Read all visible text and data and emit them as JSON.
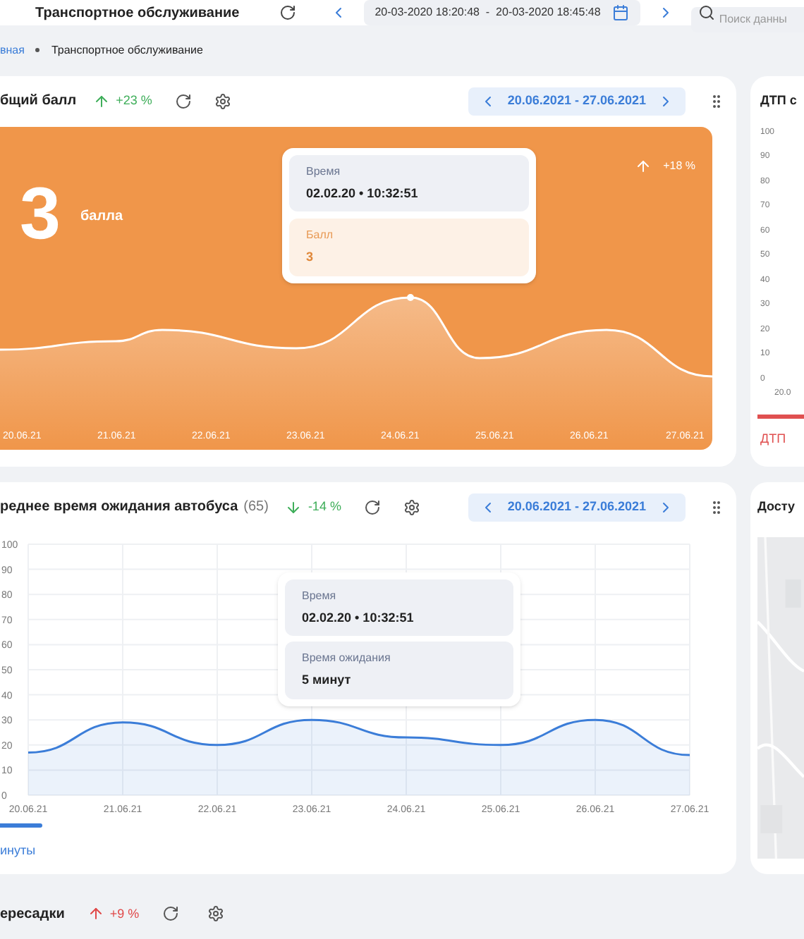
{
  "header": {
    "title": "Транспортное обслуживание",
    "date_range": "20-03-2020 18:20:48  -  20-03-2020 18:45:48",
    "search": {
      "placeholder": "Поиск данны"
    }
  },
  "breadcrumbs": [
    {
      "label": "вная",
      "selected": false
    },
    {
      "label": "Транспортное обслуживание",
      "selected": true
    }
  ],
  "score_card": {
    "title": "бщий балл",
    "trend": {
      "rising": true,
      "positive": true,
      "text": "+23 %"
    },
    "date_range": "20.06.2021 - 27.06.2021",
    "score": "3",
    "score_unit": "балла",
    "change": {
      "rising": true,
      "text": "+18 %"
    },
    "tooltip": [
      {
        "label": "Время",
        "value": "02.02.20 • 10:32:51",
        "kind": "neutral"
      },
      {
        "label": "Балл",
        "value": "3",
        "kind": "accent"
      }
    ],
    "x_labels": [
      "20.06.21",
      "21.06.21",
      "22.06.21",
      "23.06.21",
      "24.06.21",
      "25.06.21",
      "26.06.21",
      "27.06.21"
    ]
  },
  "wait_card": {
    "title": "реднее время ожидания автобуса",
    "count": "(65)",
    "trend": {
      "rising": false,
      "positive": true,
      "text": "-14 %"
    },
    "date_range": "20.06.2021 - 27.06.2021",
    "chart_data": {
      "type": "area",
      "grid": true,
      "categories": [
        "20.06.21",
        "21.06.21",
        "22.06.21",
        "23.06.21",
        "24.06.21",
        "25.06.21",
        "26.06.21",
        "27.06.21"
      ],
      "series": [
        {
          "name": "инуты",
          "color": "#3b7dd8",
          "values": [
            17,
            29,
            20,
            30,
            23,
            20,
            30,
            16
          ]
        }
      ],
      "ylim": [
        0,
        100
      ],
      "yticks": [
        0,
        10,
        20,
        30,
        40,
        50,
        60,
        70,
        80,
        90,
        100
      ]
    },
    "tooltip": [
      {
        "label": "Время",
        "value": "02.02.20 • 10:32:51",
        "kind": "neutral"
      },
      {
        "label": "Время ожидания",
        "value": "5 минут",
        "kind": "neutral"
      }
    ]
  },
  "accidents_card": {
    "title": "ДТП с",
    "axis_labels": [
      "100",
      "90",
      "80",
      "70",
      "60",
      "50",
      "40",
      "30",
      "20",
      "10",
      "0"
    ],
    "x_label": "20.0",
    "legend": "ДТП"
  },
  "access_card": {
    "title": "Досту"
  },
  "transfers_card": {
    "title": "ересадки",
    "trend": {
      "rising": true,
      "positive": false,
      "text": "+9 %"
    }
  }
}
